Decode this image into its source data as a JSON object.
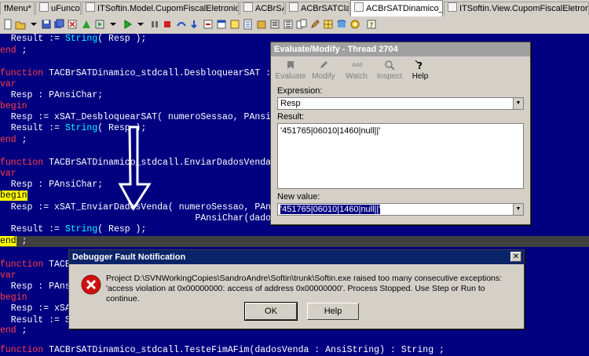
{
  "tabs": [
    {
      "label": "fMenu*",
      "active": false
    },
    {
      "label": "uFuncoes",
      "active": false
    },
    {
      "label": "ITSoftin.Model.CupomFiscalEletronico*",
      "active": false
    },
    {
      "label": "ACBrSAT",
      "active": false
    },
    {
      "label": "ACBrSATClass",
      "active": false
    },
    {
      "label": "ACBrSATDinamico_stdcall",
      "active": true
    },
    {
      "label": "ITSoftin.View.CupomFiscalEletronicoMFE*",
      "active": false
    }
  ],
  "code": [
    {
      "segments": [
        {
          "t": "  Result := ",
          "c": ""
        },
        {
          "t": "String",
          "c": "cyan"
        },
        {
          "t": "( Resp );",
          "c": ""
        }
      ]
    },
    {
      "segments": [
        {
          "t": "end",
          "c": "red"
        },
        {
          "t": " ;",
          "c": ""
        }
      ]
    },
    {
      "segments": [
        {
          "t": "",
          "c": ""
        }
      ]
    },
    {
      "segments": [
        {
          "t": "function",
          "c": "red"
        },
        {
          "t": " TACBrSATDinamico_stdcall.DesbloquearSAT : Str",
          "c": ""
        }
      ]
    },
    {
      "segments": [
        {
          "t": "var",
          "c": "red"
        }
      ]
    },
    {
      "segments": [
        {
          "t": "  Resp : PAnsiChar;",
          "c": ""
        }
      ]
    },
    {
      "segments": [
        {
          "t": "begin",
          "c": "red"
        }
      ]
    },
    {
      "segments": [
        {
          "t": "  Resp := xSAT_DesbloquearSAT( numeroSessao, PAnsiCha",
          "c": ""
        }
      ]
    },
    {
      "segments": [
        {
          "t": "  Result := ",
          "c": ""
        },
        {
          "t": "String",
          "c": "cyan"
        },
        {
          "t": "( Resp );",
          "c": ""
        }
      ]
    },
    {
      "segments": [
        {
          "t": "end",
          "c": "red"
        },
        {
          "t": " ;",
          "c": ""
        }
      ]
    },
    {
      "segments": [
        {
          "t": "",
          "c": ""
        }
      ]
    },
    {
      "segments": [
        {
          "t": "function",
          "c": "red"
        },
        {
          "t": " TACBrSATDinamico_stdcall.EnviarDadosVenda(dad",
          "c": ""
        }
      ]
    },
    {
      "segments": [
        {
          "t": "var",
          "c": "red"
        }
      ]
    },
    {
      "segments": [
        {
          "t": "  Resp : PAnsiChar;",
          "c": ""
        }
      ]
    },
    {
      "segments": [
        {
          "t": "begin",
          "c": "ybg"
        }
      ]
    },
    {
      "segments": [
        {
          "t": "  Resp := xSAT_EnviarDadosVenda( numeroSessao, PAnsiCh",
          "c": ""
        }
      ]
    },
    {
      "segments": [
        {
          "t": "                                    PAnsiChar(dadosVen",
          "c": ""
        }
      ]
    },
    {
      "segments": [
        {
          "t": "  Result := ",
          "c": ""
        },
        {
          "t": "String",
          "c": "cyan"
        },
        {
          "t": "( Resp );",
          "c": ""
        }
      ]
    },
    {
      "segments": [
        {
          "t": "end",
          "c": "ybg"
        },
        {
          "t": " ;",
          "c": ""
        }
      ],
      "hl": true
    },
    {
      "segments": [
        {
          "t": "",
          "c": ""
        }
      ]
    },
    {
      "segments": [
        {
          "t": "function",
          "c": "red"
        },
        {
          "t": " TACBr",
          "c": ""
        }
      ]
    },
    {
      "segments": [
        {
          "t": "var",
          "c": "red"
        }
      ]
    },
    {
      "segments": [
        {
          "t": "  Resp : PAnsi",
          "c": ""
        }
      ]
    },
    {
      "segments": [
        {
          "t": "begin",
          "c": "red"
        }
      ]
    },
    {
      "segments": [
        {
          "t": "  Resp := xSAT",
          "c": ""
        }
      ]
    },
    {
      "segments": [
        {
          "t": "  Result := Str",
          "c": ""
        }
      ]
    },
    {
      "segments": [
        {
          "t": "end",
          "c": "red"
        },
        {
          "t": " ;",
          "c": ""
        }
      ]
    },
    {
      "segments": [
        {
          "t": "",
          "c": ""
        }
      ]
    },
    {
      "segments": [
        {
          "t": "function",
          "c": "red"
        },
        {
          "t": " TACBrSATDinamico_stdcall.TesteFimAFim(dadosVenda : AnsiString) : String ;",
          "c": ""
        }
      ]
    }
  ],
  "evaluate": {
    "title": "Evaluate/Modify - Thread 2704",
    "buttons": [
      {
        "label": "Evaluate",
        "enabled": false,
        "icon": "evaluate-icon"
      },
      {
        "label": "Modify",
        "enabled": false,
        "icon": "modify-icon"
      },
      {
        "label": "Watch",
        "enabled": false,
        "icon": "watch-icon"
      },
      {
        "label": "Inspect",
        "enabled": false,
        "icon": "inspect-icon"
      },
      {
        "label": "Help",
        "enabled": true,
        "icon": "help-icon"
      }
    ],
    "expression_label": "Expression:",
    "expression_value": "Resp",
    "result_label": "Result:",
    "result_value": "'451765|06010|1460|null||'",
    "new_value_label": "New value:",
    "new_value": "'451765|06010|1460|null||'"
  },
  "fault": {
    "title": "Debugger Fault Notification",
    "message": "Project D:\\SVNWorkingCopies\\SandroAndre\\Softin\\trunk\\Softin.exe raised too many consecutive exceptions: 'access violation at 0x00000000: access of address 0x00000000'. Process Stopped. Use Step or Run to continue.",
    "ok_label": "OK",
    "help_label": "Help",
    "icon": "error-icon"
  },
  "colors": {
    "editor_bg": "#000080",
    "keyword": "#ff4040",
    "type": "#00ffff",
    "highlight": "#ffff00"
  }
}
